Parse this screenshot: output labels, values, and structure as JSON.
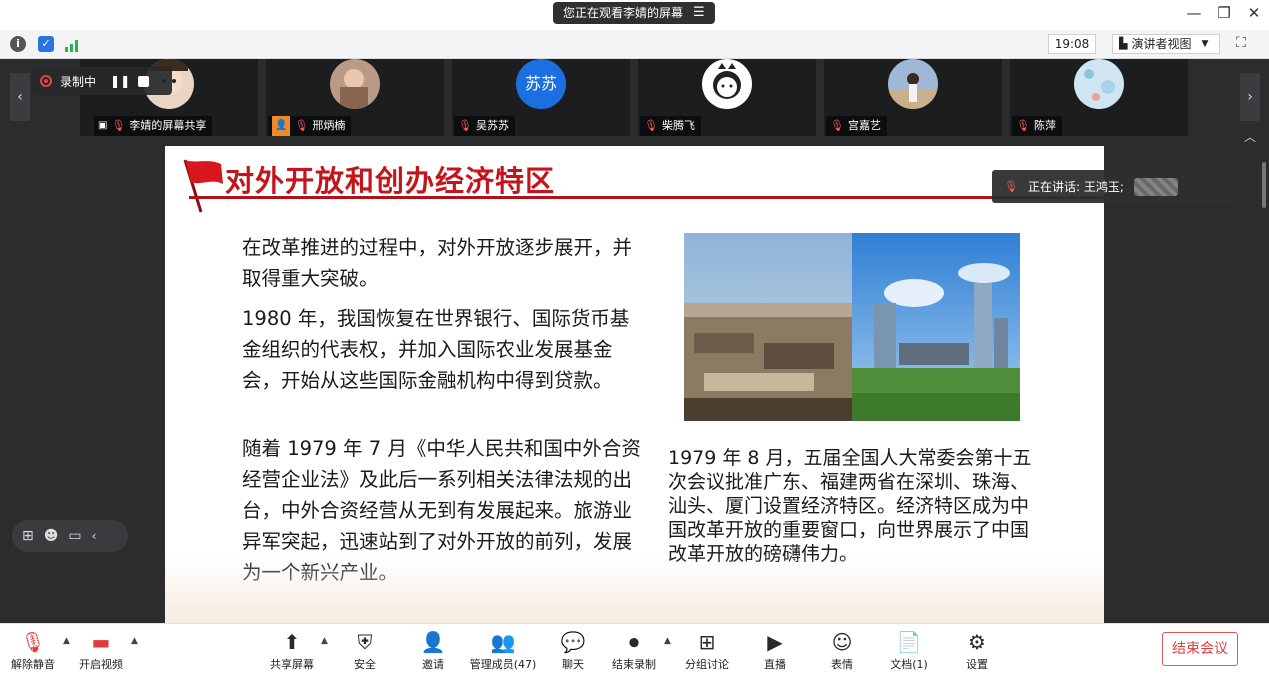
{
  "topbar": {
    "sharing_text": "您正在观看李婧的屏幕",
    "time": "19:08",
    "view_mode": "演讲者视图"
  },
  "recording": {
    "label": "录制中"
  },
  "participants": [
    {
      "name": "李婧的屏幕共享"
    },
    {
      "name": "邢炳楠"
    },
    {
      "name": "吴苏苏",
      "avatar_text": "苏苏"
    },
    {
      "name": "柴腾飞"
    },
    {
      "name": "宫嘉艺"
    },
    {
      "name": "陈萍"
    }
  ],
  "speaking": {
    "label": "正在讲话: 王鸿玉;"
  },
  "slide": {
    "title": "对外开放和创办经济特区",
    "left_paragraphs": [
      "在改革推进的过程中，对外开放逐步展开，并取得重大突破。",
      "1980 年，我国恢复在世界银行、国际货币基金组织的代表权，并加入国际农业发展基金会，开始从这些国际金融机构中得到贷款。",
      "随着 1979 年 7 月《中华人民共和国中外合资经营企业法》及此后一系列相关法律法规的出台，中外合资经营从无到有发展起来。旅游业异军突起，迅速站到了对外开放的前列，发展为一个新兴产业。"
    ],
    "right_paragraph": "1979 年 8 月，五届全国人大常委会第十五次会议批准广东、福建两省在深圳、珠海、汕头、厦门设置经济特区。经济特区成为中国改革开放的重要窗口，向世界展示了中国改革开放的磅礴伟力。"
  },
  "toolbar": {
    "unmute": "解除静音",
    "start_video": "开启视频",
    "share_screen": "共享屏幕",
    "security": "安全",
    "invite": "邀请",
    "manage_members": "管理成员(47)",
    "chat": "聊天",
    "end_recording": "结束录制",
    "breakout": "分组讨论",
    "live": "直播",
    "reactions": "表情",
    "docs": "文档(1)",
    "settings": "设置",
    "end_meeting": "结束会议"
  },
  "colors": {
    "accent_red": "#c4151c",
    "end_btn": "#e03c3c",
    "avatar_blue": "#1c6fe0"
  }
}
